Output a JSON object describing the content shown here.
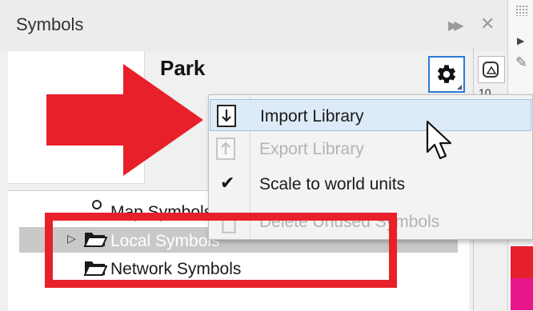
{
  "panel": {
    "title": "Symbols",
    "symbol_name": "Park",
    "side_icon_label": "10",
    "expand_icon": "double-chevron-right-icon",
    "close_icon": "close-icon"
  },
  "gear_menu": {
    "items": [
      {
        "label": "Import Library",
        "icon": "import-icon",
        "enabled": true,
        "highlighted": true
      },
      {
        "label": "Export Library",
        "icon": "export-icon",
        "enabled": false
      },
      {
        "label": "Scale to world units",
        "icon": "check-icon",
        "enabled": true,
        "checked": true
      },
      {
        "label": "Delete Unused Symbols",
        "icon": "trash-icon",
        "enabled": false
      }
    ]
  },
  "tree": {
    "items": [
      {
        "label": "Map Symbols",
        "icon": "map-symbol-icon"
      },
      {
        "label": "Local Symbols",
        "icon": "folder-icon",
        "selected": true,
        "expandable": true
      },
      {
        "label": "Network Symbols",
        "icon": "folder-icon"
      }
    ]
  },
  "colors": {
    "accent": "#2b7bd6",
    "highlight": "#ddeaf7",
    "annotation_red": "#e8202a",
    "swatch_red": "#e6202a",
    "swatch_magenta": "#e8168b"
  }
}
